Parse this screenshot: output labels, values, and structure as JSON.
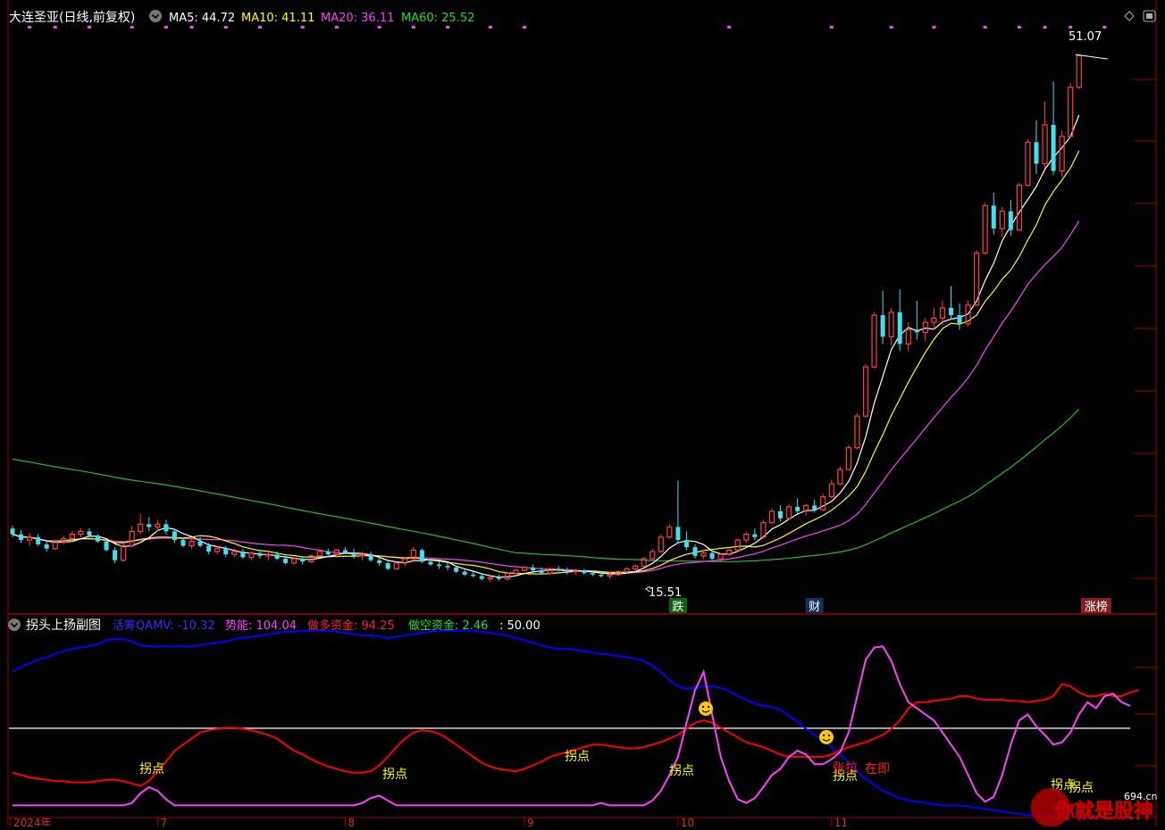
{
  "colors": {
    "up": "#ff4040",
    "down": "#40e0f0",
    "ma5": "#ffffff",
    "ma10": "#ffff00",
    "ma20": "#ff40ff",
    "ma60": "#20c020",
    "frame": "#a00000",
    "qamv": "#0000ff",
    "shineng": "#ff40ff",
    "zuoduo": "#ff0000",
    "zuokong": "#00cc00",
    "yellow": "#ffff00",
    "baseline": "#ffffff"
  },
  "main": {
    "stock_name": "大连圣亚(日线,前复权)",
    "ma_legend": [
      {
        "key": "ma5",
        "label": "MA5: 44.72"
      },
      {
        "key": "ma10",
        "label": "MA10: 41.11"
      },
      {
        "key": "ma20",
        "label": "MA20: 36.11"
      },
      {
        "key": "ma60",
        "label": "MA60: 25.52"
      }
    ],
    "high_label": "51.07",
    "low_label": "15.51",
    "events": [
      {
        "label": "跌",
        "day": 78,
        "bg": "#106010",
        "fg": "#ffffff"
      },
      {
        "label": "财",
        "day": 94,
        "bg": "#103060",
        "fg": "#ffffff"
      },
      {
        "label": "涨榜",
        "day": 127,
        "bg": "#802020",
        "fg": "#ffffff"
      }
    ]
  },
  "sub": {
    "title": "拐头上扬副图",
    "legend": [
      {
        "key": "qamv",
        "label": "活筹QAMV: -10.32"
      },
      {
        "key": "shineng",
        "label": "势能: 104.04"
      },
      {
        "key": "zuoduo",
        "label": "做多资金: 94.25"
      },
      {
        "key": "zuokong",
        "label": "做空资金: 2.46"
      },
      {
        "key": "line50",
        "label": ": 50.00"
      }
    ],
    "markers": [
      {
        "label": "拐点",
        "day": 15
      },
      {
        "label": "拐点",
        "day": 42
      },
      {
        "label": "拐点",
        "day": 64
      },
      {
        "label": "拐点",
        "day": 75
      },
      {
        "label": "拐点",
        "day": 92
      },
      {
        "label": "张拉",
        "day": 92
      },
      {
        "label": "在即",
        "day": 96
      },
      {
        "label": "拐点",
        "day": 118
      },
      {
        "label": "拐点",
        "day": 120
      }
    ],
    "smileys": [
      {
        "day": 78
      },
      {
        "day": 91
      }
    ]
  },
  "date_axis": [
    {
      "label": "2024年",
      "day": 0
    },
    {
      "label": "7",
      "day": 17
    },
    {
      "label": "8",
      "day": 39
    },
    {
      "label": "9",
      "day": 60
    },
    {
      "label": "10",
      "day": 78
    },
    {
      "label": "11",
      "day": 96
    }
  ],
  "watermark": {
    "main": "你就是股神",
    "site": "694.cn"
  },
  "chart_data": {
    "type": "candlestick",
    "ylim": [
      14,
      53
    ],
    "sub_ylim": [
      -40,
      110
    ],
    "ohlc": [
      [
        18.2,
        18.4,
        17.6,
        17.8
      ],
      [
        17.8,
        18.1,
        17.2,
        17.4
      ],
      [
        17.4,
        17.9,
        17.0,
        17.6
      ],
      [
        17.6,
        17.8,
        17.0,
        17.1
      ],
      [
        17.1,
        17.3,
        16.6,
        16.8
      ],
      [
        16.8,
        17.4,
        16.7,
        17.3
      ],
      [
        17.3,
        17.7,
        17.1,
        17.5
      ],
      [
        17.5,
        18.0,
        17.3,
        17.8
      ],
      [
        17.8,
        18.2,
        17.6,
        18.0
      ],
      [
        18.0,
        18.2,
        17.6,
        17.7
      ],
      [
        17.7,
        17.8,
        17.2,
        17.3
      ],
      [
        17.3,
        17.4,
        16.6,
        16.7
      ],
      [
        16.7,
        16.9,
        15.8,
        16.0
      ],
      [
        16.0,
        17.2,
        15.9,
        17.0
      ],
      [
        17.0,
        18.4,
        16.9,
        18.0
      ],
      [
        18.0,
        19.2,
        17.8,
        18.5
      ],
      [
        18.5,
        19.0,
        18.0,
        18.3
      ],
      [
        18.3,
        18.8,
        18.0,
        18.5
      ],
      [
        18.5,
        18.8,
        17.8,
        18.0
      ],
      [
        18.0,
        18.2,
        17.2,
        17.4
      ],
      [
        17.4,
        17.6,
        16.9,
        17.0
      ],
      [
        17.0,
        17.5,
        16.8,
        17.3
      ],
      [
        17.3,
        17.6,
        16.9,
        17.0
      ],
      [
        17.0,
        17.2,
        16.4,
        16.6
      ],
      [
        16.6,
        17.0,
        16.4,
        16.8
      ],
      [
        16.8,
        17.0,
        16.2,
        16.4
      ],
      [
        16.4,
        16.8,
        16.2,
        16.6
      ],
      [
        16.6,
        16.8,
        16.1,
        16.2
      ],
      [
        16.2,
        16.6,
        16.0,
        16.5
      ],
      [
        16.5,
        16.6,
        16.1,
        16.3
      ],
      [
        16.3,
        16.6,
        16.0,
        16.4
      ],
      [
        16.4,
        16.6,
        16.0,
        16.1
      ],
      [
        16.1,
        16.3,
        15.7,
        15.8
      ],
      [
        15.8,
        16.2,
        15.7,
        16.1
      ],
      [
        16.1,
        16.3,
        15.7,
        15.9
      ],
      [
        15.9,
        16.4,
        15.8,
        16.3
      ],
      [
        16.3,
        16.7,
        16.2,
        16.6
      ],
      [
        16.6,
        16.8,
        16.2,
        16.4
      ],
      [
        16.4,
        16.8,
        16.2,
        16.7
      ],
      [
        16.7,
        16.9,
        16.4,
        16.5
      ],
      [
        16.5,
        16.8,
        16.1,
        16.3
      ],
      [
        16.3,
        16.6,
        16.0,
        16.4
      ],
      [
        16.4,
        16.6,
        15.9,
        16.0
      ],
      [
        16.0,
        16.3,
        15.6,
        15.8
      ],
      [
        15.8,
        15.9,
        15.3,
        15.4
      ],
      [
        15.4,
        15.9,
        15.3,
        15.8
      ],
      [
        15.8,
        16.2,
        15.6,
        16.1
      ],
      [
        16.1,
        16.9,
        16.0,
        16.7
      ],
      [
        16.7,
        16.8,
        15.8,
        15.9
      ],
      [
        15.9,
        16.1,
        15.6,
        15.7
      ],
      [
        15.7,
        15.9,
        15.4,
        15.6
      ],
      [
        15.6,
        15.8,
        15.3,
        15.5
      ],
      [
        15.5,
        15.6,
        15.1,
        15.2
      ],
      [
        15.2,
        15.4,
        14.9,
        15.0
      ],
      [
        15.0,
        15.2,
        14.8,
        14.9
      ],
      [
        14.9,
        15.1,
        14.6,
        14.7
      ],
      [
        14.7,
        15.0,
        14.5,
        14.8
      ],
      [
        14.8,
        15.0,
        14.6,
        14.7
      ],
      [
        14.7,
        15.2,
        14.6,
        15.1
      ],
      [
        15.1,
        15.4,
        15.0,
        15.3
      ],
      [
        15.3,
        15.6,
        15.2,
        15.5
      ],
      [
        15.5,
        15.7,
        15.2,
        15.3
      ],
      [
        15.3,
        15.5,
        15.0,
        15.1
      ],
      [
        15.1,
        15.5,
        15.0,
        15.4
      ],
      [
        15.4,
        15.6,
        15.2,
        15.3
      ],
      [
        15.3,
        15.5,
        15.0,
        15.2
      ],
      [
        15.2,
        15.4,
        15.0,
        15.3
      ],
      [
        15.3,
        15.4,
        15.0,
        15.1
      ],
      [
        15.1,
        15.3,
        14.9,
        15.0
      ],
      [
        15.0,
        15.2,
        14.8,
        14.9
      ],
      [
        14.9,
        15.2,
        14.7,
        15.0
      ],
      [
        15.0,
        15.3,
        14.9,
        15.2
      ],
      [
        15.2,
        15.5,
        15.1,
        15.4
      ],
      [
        15.4,
        15.7,
        15.2,
        15.6
      ],
      [
        15.6,
        16.2,
        15.5,
        16.1
      ],
      [
        16.1,
        16.8,
        16.0,
        16.6
      ],
      [
        16.6,
        17.8,
        16.5,
        17.6
      ],
      [
        17.6,
        18.5,
        17.5,
        18.3
      ],
      [
        18.3,
        21.5,
        17.2,
        17.4
      ],
      [
        17.4,
        18.0,
        16.7,
        16.9
      ],
      [
        16.9,
        17.1,
        16.1,
        16.3
      ],
      [
        16.3,
        16.7,
        16.1,
        16.5
      ],
      [
        16.5,
        16.7,
        16.0,
        16.1
      ],
      [
        16.1,
        16.5,
        15.9,
        16.4
      ],
      [
        16.4,
        16.8,
        16.3,
        16.7
      ],
      [
        16.7,
        17.5,
        16.6,
        17.4
      ],
      [
        17.4,
        18.0,
        17.2,
        17.8
      ],
      [
        17.8,
        18.2,
        17.4,
        17.6
      ],
      [
        17.6,
        18.8,
        17.5,
        18.6
      ],
      [
        18.6,
        19.6,
        18.5,
        19.4
      ],
      [
        19.4,
        19.8,
        18.7,
        18.9
      ],
      [
        18.9,
        19.9,
        18.8,
        19.7
      ],
      [
        19.7,
        20.3,
        19.2,
        19.4
      ],
      [
        19.4,
        19.9,
        19.1,
        19.8
      ],
      [
        19.8,
        20.2,
        19.3,
        19.5
      ],
      [
        19.5,
        20.6,
        19.4,
        20.4
      ],
      [
        20.4,
        21.6,
        20.3,
        21.3
      ],
      [
        21.3,
        22.5,
        21.2,
        22.3
      ],
      [
        22.3,
        24.0,
        22.2,
        23.8
      ],
      [
        23.8,
        26.2,
        23.7,
        26.0
      ],
      [
        26.0,
        29.6,
        25.9,
        29.4
      ],
      [
        29.4,
        33.2,
        29.3,
        33.0
      ],
      [
        33.0,
        34.7,
        31.0,
        31.5
      ],
      [
        31.5,
        33.5,
        30.9,
        33.2
      ],
      [
        33.2,
        34.8,
        30.5,
        31.0
      ],
      [
        31.0,
        32.5,
        30.5,
        32.0
      ],
      [
        32.0,
        34.0,
        31.3,
        31.8
      ],
      [
        31.8,
        32.8,
        31.2,
        32.5
      ],
      [
        32.5,
        33.5,
        32.0,
        32.8
      ],
      [
        32.8,
        34.0,
        32.3,
        33.5
      ],
      [
        33.5,
        35.0,
        32.7,
        33.0
      ],
      [
        33.0,
        33.8,
        32.0,
        32.4
      ],
      [
        32.4,
        34.0,
        32.2,
        33.7
      ],
      [
        33.7,
        37.5,
        33.6,
        37.3
      ],
      [
        37.3,
        40.8,
        37.2,
        40.6
      ],
      [
        40.6,
        41.5,
        38.6,
        39.0
      ],
      [
        39.0,
        40.5,
        38.4,
        40.2
      ],
      [
        40.2,
        41.0,
        38.5,
        38.9
      ],
      [
        38.9,
        42.2,
        38.8,
        42.0
      ],
      [
        42.0,
        45.2,
        41.9,
        45.0
      ],
      [
        45.0,
        46.5,
        42.8,
        43.5
      ],
      [
        43.5,
        47.8,
        43.2,
        46.2
      ],
      [
        46.2,
        49.2,
        42.7,
        43.0
      ],
      [
        43.0,
        45.8,
        42.6,
        45.4
      ],
      [
        45.4,
        49.1,
        45.3,
        48.8
      ],
      [
        48.8,
        51.07,
        48.7,
        51.0
      ]
    ],
    "qamv": [
      80,
      84,
      87,
      90,
      92,
      95,
      97,
      99,
      100,
      101,
      103,
      106,
      107,
      107,
      105,
      102,
      101,
      101,
      101,
      101,
      101,
      101,
      102,
      103,
      104,
      105,
      107,
      108,
      109,
      110,
      111,
      112,
      113,
      113,
      114,
      114,
      114,
      114,
      113,
      112,
      111,
      110,
      110,
      109,
      108,
      109,
      110,
      111,
      112,
      113,
      114,
      114,
      114,
      114,
      114,
      113,
      112,
      111,
      110,
      108,
      106,
      104,
      102,
      100,
      99,
      99,
      98,
      97,
      96,
      95,
      94,
      93,
      92,
      91,
      89,
      85,
      80,
      73,
      68,
      66,
      67,
      68,
      68,
      67,
      64,
      60,
      57,
      54,
      52,
      51,
      49,
      44,
      39,
      33,
      28,
      24,
      18,
      12,
      5,
      -2,
      -8,
      -13,
      -18,
      -21,
      -24,
      -26,
      -27,
      -28,
      -29,
      -30,
      -30,
      -30,
      -31,
      -32,
      -33,
      -34,
      -35,
      -36,
      -37,
      -38,
      -39,
      -38,
      -38,
      -37,
      -37,
      -36
    ],
    "shineng": [
      -30,
      -30,
      -30,
      -30,
      -30,
      -30,
      -30,
      -30,
      -30,
      -30,
      -30,
      -30,
      -30,
      -30,
      -28,
      -20,
      -15,
      -18,
      -25,
      -30,
      -30,
      -30,
      -30,
      -30,
      -30,
      -30,
      -30,
      -30,
      -30,
      -30,
      -30,
      -30,
      -30,
      -30,
      -30,
      -30,
      -30,
      -30,
      -30,
      -30,
      -30,
      -28,
      -24,
      -22,
      -26,
      -30,
      -30,
      -30,
      -30,
      -30,
      -30,
      -30,
      -30,
      -30,
      -30,
      -30,
      -30,
      -30,
      -30,
      -30,
      -30,
      -30,
      -30,
      -30,
      -30,
      -30,
      -30,
      -30,
      -30,
      -28,
      -30,
      -30,
      -30,
      -30,
      -30,
      -26,
      -18,
      -5,
      10,
      38,
      65,
      80,
      45,
      10,
      -10,
      -25,
      -28,
      -24,
      -15,
      -5,
      0,
      10,
      15,
      12,
      4,
      4,
      8,
      14,
      30,
      60,
      90,
      100,
      101,
      89,
      70,
      55,
      50,
      45,
      40,
      30,
      20,
      10,
      -5,
      -20,
      -27,
      -23,
      -5,
      20,
      40,
      45,
      35,
      28,
      20,
      22,
      30,
      45,
      55,
      50,
      60,
      62,
      55,
      52
    ],
    "zuoduo": [
      -3,
      -5,
      -7,
      -8,
      -9,
      -10,
      -10,
      -11,
      -11,
      -11,
      -10,
      -9,
      -9,
      -10,
      -12,
      -14,
      -10,
      -2,
      6,
      15,
      20,
      25,
      30,
      32,
      33,
      34,
      34,
      33,
      32,
      30,
      28,
      25,
      20,
      15,
      12,
      8,
      5,
      2,
      0,
      -2,
      -3,
      -3,
      -2,
      3,
      10,
      18,
      25,
      30,
      32,
      31,
      29,
      25,
      20,
      15,
      10,
      5,
      2,
      0,
      -1,
      -2,
      0,
      3,
      6,
      10,
      12,
      14,
      16,
      18,
      20,
      20,
      19,
      18,
      17,
      17,
      18,
      20,
      22,
      25,
      28,
      33,
      38,
      40,
      38,
      34,
      30,
      26,
      22,
      20,
      18,
      15,
      12,
      10,
      10,
      10,
      10,
      10,
      12,
      15,
      18,
      20,
      22,
      25,
      28,
      33,
      40,
      50,
      55,
      55,
      56,
      57,
      58,
      60,
      60,
      58,
      57,
      57,
      57,
      56,
      56,
      55,
      56,
      57,
      60,
      70,
      68,
      63,
      60,
      60,
      62,
      60,
      60,
      63,
      65
    ]
  }
}
